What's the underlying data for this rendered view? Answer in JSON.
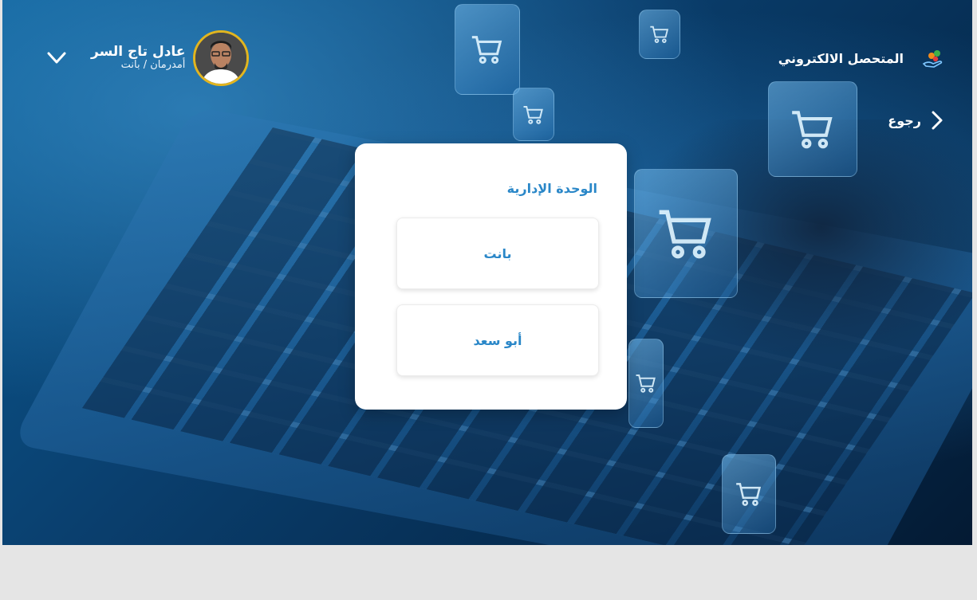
{
  "header": {
    "brand_label": "المتحصل الالكتروني",
    "back_label": "رجوع"
  },
  "user": {
    "name": "عادل تاج السر",
    "location": "أمدرمان / بانت"
  },
  "modal": {
    "title": "الوحدة الإدارية",
    "options": [
      "بانت",
      "أبو سعد"
    ]
  },
  "colors": {
    "accent": "#2a87c8",
    "avatar_ring": "#e2b51f",
    "hero_dark": "#0a3f6e",
    "page_bg": "#e5e5e5"
  },
  "icons": {
    "brand": "coins-hand-icon",
    "back": "chevron-right-icon",
    "user_menu": "chevron-down-icon",
    "tiles": "shopping-cart-icon"
  }
}
